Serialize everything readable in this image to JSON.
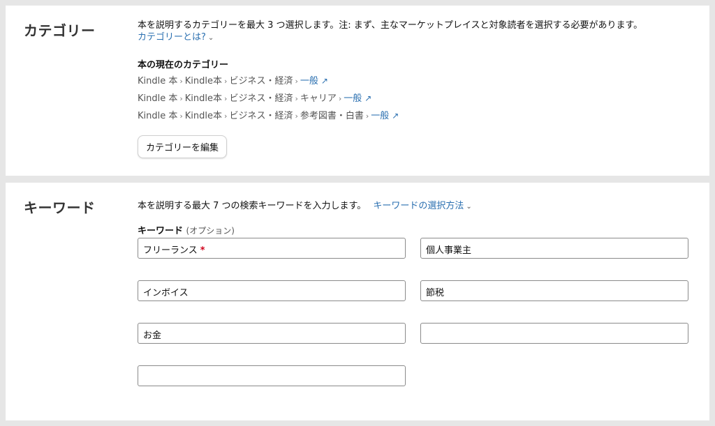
{
  "categories": {
    "title": "カテゴリー",
    "description": "本を説明するカテゴリーを最大 3 つ選択します。注: まず、主なマーケットプレイスと対象読者を選択する必要があります。",
    "help_link": "カテゴリーとは?",
    "current_heading": "本の現在のカテゴリー",
    "paths": [
      {
        "segments": [
          "Kindle 本",
          "Kindle本",
          "ビジネス・経済"
        ],
        "leaf": "一般"
      },
      {
        "segments": [
          "Kindle 本",
          "Kindle本",
          "ビジネス・経済",
          "キャリア"
        ],
        "leaf": "一般"
      },
      {
        "segments": [
          "Kindle 本",
          "Kindle本",
          "ビジネス・経済",
          "参考図書・白書"
        ],
        "leaf": "一般"
      }
    ],
    "edit_button": "カテゴリーを編集"
  },
  "keywords": {
    "title": "キーワード",
    "description": "本を説明する最大 7 つの検索キーワードを入力します。",
    "help_link": "キーワードの選択方法",
    "field_label": "キーワード",
    "field_label_optional": "(オプション)",
    "values": [
      "フリーランス",
      "個人事業主",
      "インボイス",
      "節税",
      "お金",
      "",
      ""
    ],
    "required_marker": "*"
  },
  "colors": {
    "link": "#2a6fb0",
    "required": "#d0021b"
  }
}
